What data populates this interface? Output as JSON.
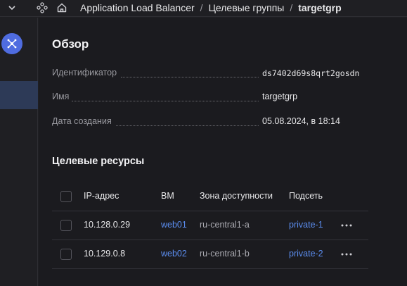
{
  "breadcrumb": {
    "items": [
      "Application Load Balancer",
      "Целевые группы",
      "targetgrp"
    ]
  },
  "overview": {
    "title": "Обзор",
    "fields": [
      {
        "label": "Идентификатор",
        "value": "ds7402d69s8qrt2gosdn"
      },
      {
        "label": "Имя",
        "value": "targetgrp"
      },
      {
        "label": "Дата создания",
        "value": "05.08.2024, в 18:14"
      }
    ]
  },
  "resources": {
    "title": "Целевые ресурсы",
    "columns": [
      "IP-адрес",
      "ВМ",
      "Зона доступности",
      "Подсеть"
    ],
    "rows": [
      {
        "ip": "10.128.0.29",
        "vm": "web01",
        "zone": "ru-central1-a",
        "subnet": "private-1"
      },
      {
        "ip": "10.129.0.8",
        "vm": "web02",
        "zone": "ru-central1-b",
        "subnet": "private-2"
      }
    ]
  },
  "colors": {
    "accent": "#5b8def",
    "logo": "#4f6ce0",
    "background": "#1b1b1f"
  }
}
